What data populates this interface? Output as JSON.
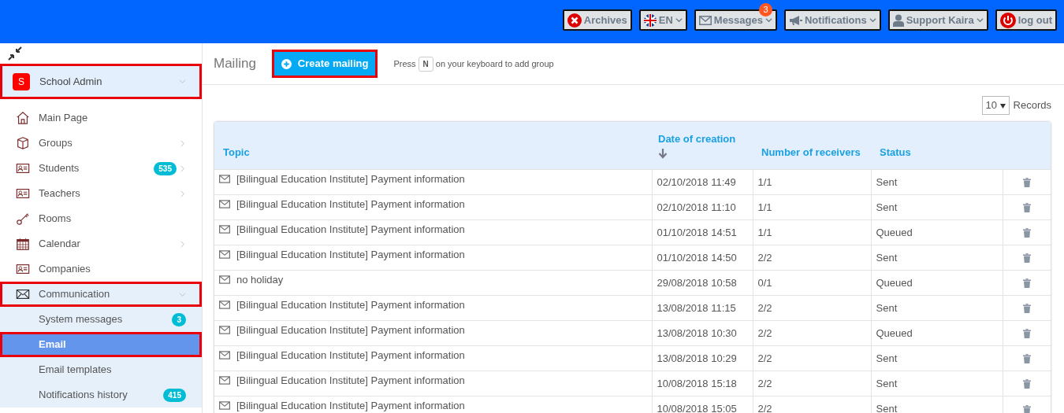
{
  "topbar": {
    "buttons": [
      {
        "kind": "archives",
        "label": "Archives",
        "dropdown": false
      },
      {
        "kind": "language",
        "label": "EN",
        "dropdown": true
      },
      {
        "kind": "messages",
        "label": "Messages",
        "dropdown": true,
        "badge": "3"
      },
      {
        "kind": "notifications",
        "label": "Notifications",
        "dropdown": true
      },
      {
        "kind": "user",
        "label": "Support Kaira",
        "dropdown": true
      },
      {
        "kind": "logout",
        "label": "log out",
        "dropdown": false
      }
    ]
  },
  "sidebar": {
    "account": {
      "initial": "S",
      "name": "School Admin",
      "highlighted": true
    },
    "items": [
      {
        "kind": "home",
        "label": "Main Page",
        "has_children": false,
        "expanded": false,
        "highlighted": false
      },
      {
        "kind": "box",
        "label": "Groups",
        "has_children": true,
        "expanded": false,
        "highlighted": false
      },
      {
        "kind": "card",
        "label": "Students",
        "has_children": true,
        "expanded": false,
        "highlighted": false,
        "badge": "535"
      },
      {
        "kind": "card",
        "label": "Teachers",
        "has_children": true,
        "expanded": false,
        "highlighted": false
      },
      {
        "kind": "key",
        "label": "Rooms",
        "has_children": false,
        "expanded": false,
        "highlighted": false
      },
      {
        "kind": "calendar",
        "label": "Calendar",
        "has_children": true,
        "expanded": false,
        "highlighted": false
      },
      {
        "kind": "card",
        "label": "Companies",
        "has_children": false,
        "expanded": false,
        "highlighted": false
      },
      {
        "kind": "envelope",
        "label": "Communication",
        "has_children": true,
        "expanded": true,
        "highlighted": true,
        "children": [
          {
            "label": "System messages",
            "badge": "3",
            "selected": false,
            "highlighted": false
          },
          {
            "label": "Email",
            "selected": true,
            "highlighted": true
          },
          {
            "label": "Email templates",
            "selected": false,
            "highlighted": false
          },
          {
            "label": "Notifications history",
            "badge": "415",
            "selected": false,
            "highlighted": false
          }
        ]
      }
    ]
  },
  "header": {
    "title": "Mailing",
    "create_button": {
      "label": "Create mailing",
      "highlighted": true
    },
    "hint_before": "Press",
    "key": "N",
    "hint_after": "on your keyboard to add group"
  },
  "page_size": {
    "value": "10",
    "label": "Records"
  },
  "table": {
    "columns": [
      {
        "label": "Topic",
        "sorted": false
      },
      {
        "label": "Date of creation",
        "sorted": true
      },
      {
        "label": "Number of receivers",
        "sorted": false
      },
      {
        "label": "Status",
        "sorted": false
      }
    ],
    "rows": [
      {
        "topic": "[Bilingual Education Institute] Payment information",
        "date": "02/10/2018 11:49",
        "receivers": "1/1",
        "status": "Sent"
      },
      {
        "topic": "[Bilingual Education Institute] Payment information",
        "date": "02/10/2018 11:10",
        "receivers": "1/1",
        "status": "Sent"
      },
      {
        "topic": "[Bilingual Education Institute] Payment information",
        "date": "01/10/2018 14:51",
        "receivers": "1/1",
        "status": "Queued"
      },
      {
        "topic": "[Bilingual Education Institute] Payment information",
        "date": "01/10/2018 14:50",
        "receivers": "2/2",
        "status": "Sent"
      },
      {
        "topic": "no holiday",
        "date": "29/08/2018 10:58",
        "receivers": "0/1",
        "status": "Queued"
      },
      {
        "topic": "[Bilingual Education Institute] Payment information",
        "date": "13/08/2018 11:15",
        "receivers": "2/2",
        "status": "Sent"
      },
      {
        "topic": "[Bilingual Education Institute] Payment information",
        "date": "13/08/2018 10:30",
        "receivers": "2/2",
        "status": "Queued"
      },
      {
        "topic": "[Bilingual Education Institute] Payment information",
        "date": "13/08/2018 10:29",
        "receivers": "2/2",
        "status": "Sent"
      },
      {
        "topic": "[Bilingual Education Institute] Payment information",
        "date": "10/08/2018 15:18",
        "receivers": "2/2",
        "status": "Sent"
      },
      {
        "topic": "[Bilingual Education Institute] Payment information",
        "date": "10/08/2018 15:05",
        "receivers": "2/2",
        "status": "Sent"
      }
    ]
  }
}
